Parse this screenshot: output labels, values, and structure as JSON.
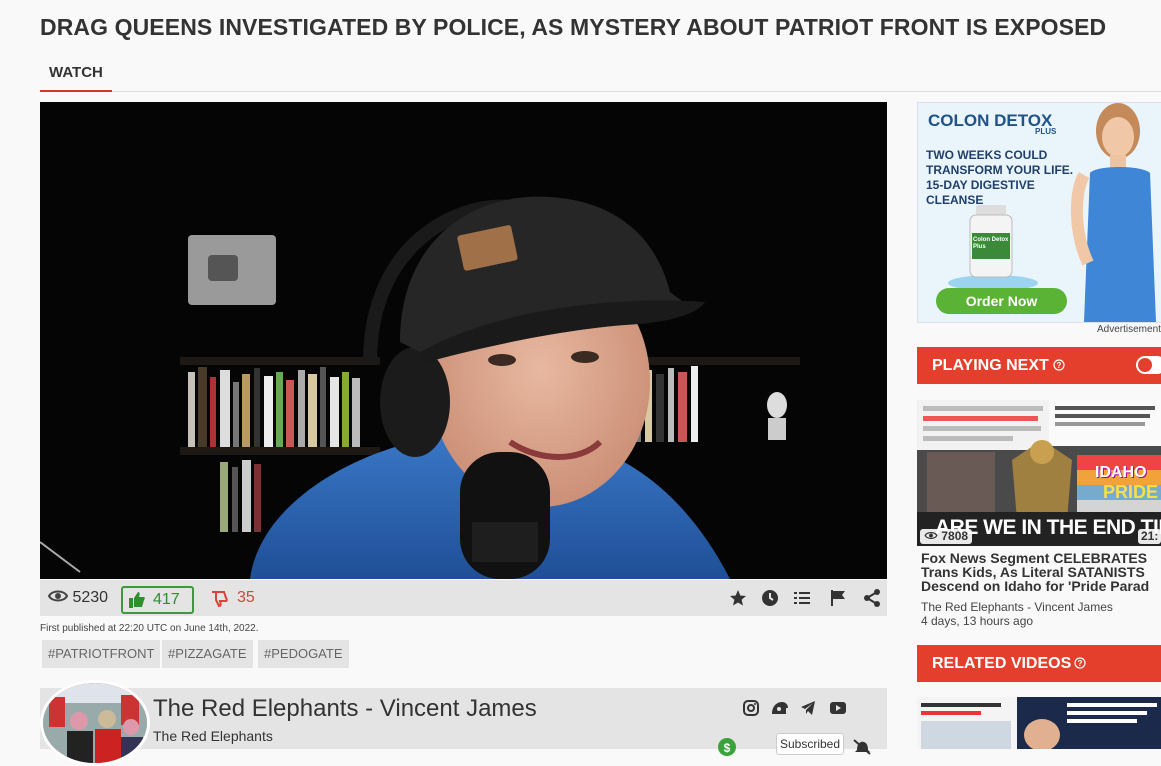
{
  "page": {
    "title": "DRAG QUEENS INVESTIGATED BY POLICE, AS MYSTERY ABOUT PATRIOT FRONT IS EXPOSED",
    "tab_watch": "WATCH"
  },
  "video": {
    "views": "5230",
    "likes": "417",
    "dislikes": "35",
    "published": "First published at 22:20 UTC on June 14th, 2022.",
    "tags": [
      "#PATRIOTFRONT",
      "#PIZZAGATE",
      "#PEDOGATE"
    ],
    "actions": [
      "star-icon",
      "clock-icon",
      "list-icon",
      "flag-icon",
      "share-icon"
    ]
  },
  "channel": {
    "name": "The Red Elephants - Vincent James",
    "handle": "The Red Elephants",
    "subscribe_label": "Subscribed",
    "social_icons": [
      "instagram-icon",
      "gab-icon",
      "telegram-icon",
      "youtube-icon"
    ]
  },
  "ad": {
    "brand": "COLON DETOX",
    "brand_sub": "PLUS",
    "headline": "TWO WEEKS COULD TRANSFORM YOUR LIFE. 15-DAY DIGESTIVE CLEANSE",
    "bottle_label": "Colon Detox Plus",
    "cta": "Order Now",
    "label": "Advertisement"
  },
  "sidebar": {
    "playing_next": "PLAYING NEXT",
    "related_videos": "RELATED VIDEOS",
    "next_video": {
      "views": "7808",
      "duration": "21:",
      "overlay_text": "ARE WE IN THE END TIMES?",
      "overlay_idaho": "IDAHO",
      "overlay_pride": "PRIDE",
      "title": "Fox News Segment CELEBRATES Trans Kids, As Literal SATANISTS Descend on Idaho for 'Pride Parad",
      "channel": "The Red Elephants - Vincent James",
      "age": "4 days, 13 hours ago"
    }
  },
  "colors": {
    "accent_red": "#e43f2d",
    "like_green": "#3c9a3c",
    "dislike_red": "#d9433a"
  }
}
